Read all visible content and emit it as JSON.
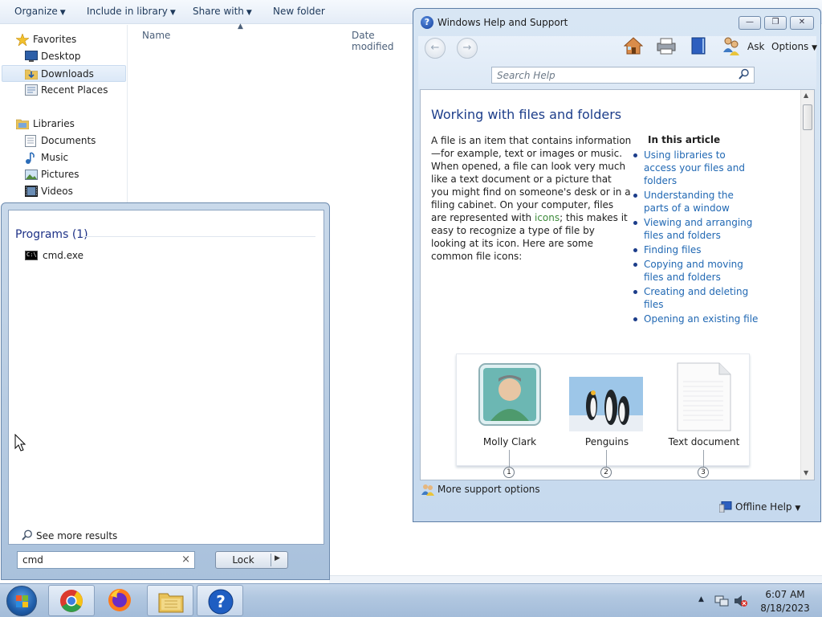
{
  "explorer": {
    "toolbar": {
      "organize": "Organize",
      "include_in_library": "Include in library",
      "share_with": "Share with",
      "new_folder": "New folder"
    },
    "nav": {
      "favorites": "Favorites",
      "desktop": "Desktop",
      "downloads": "Downloads",
      "recent_places": "Recent Places",
      "libraries": "Libraries",
      "documents": "Documents",
      "music": "Music",
      "pictures": "Pictures",
      "videos": "Videos"
    },
    "columns": {
      "name": "Name",
      "date_modified": "Date modified"
    }
  },
  "start_menu": {
    "programs_header": "Programs (1)",
    "program_item": "cmd.exe",
    "see_more_results": "See more results",
    "search_value": "cmd",
    "lock_label": "Lock"
  },
  "help_window": {
    "title": "Windows Help and Support",
    "ask": "Ask",
    "options": "Options",
    "search_placeholder": "Search Help",
    "article": {
      "title": "Working with files and folders",
      "body_part1": "A file is an item that contains information—for example, text or images or music. When opened, a file can look very much like a text document or a picture that you might find on someone's desk or in a filing cabinet. On your computer, files are represented with ",
      "body_link": "icons",
      "body_part2": "; this makes it easy to recognize a type of file by looking at its icon. Here are some common file icons:",
      "toc_title": "In this article",
      "toc_items": [
        "Using libraries to access your files and folders",
        "Understanding the parts of a window",
        "Viewing and arranging files and folders",
        "Finding files",
        "Copying and moving files and folders",
        "Creating and deleting files",
        "Opening an existing file"
      ],
      "icons": [
        {
          "caption": "Molly Clark",
          "number": "1"
        },
        {
          "caption": "Penguins",
          "number": "2"
        },
        {
          "caption": "Text document",
          "number": "3"
        }
      ]
    },
    "more_support": "More support options",
    "offline_help": "Offline Help"
  },
  "taskbar": {
    "apps": [
      "start-orb",
      "chrome-icon",
      "firefox-icon",
      "file-explorer-icon",
      "help-icon"
    ],
    "clock_time": "6:07 AM",
    "clock_date": "8/18/2023"
  }
}
